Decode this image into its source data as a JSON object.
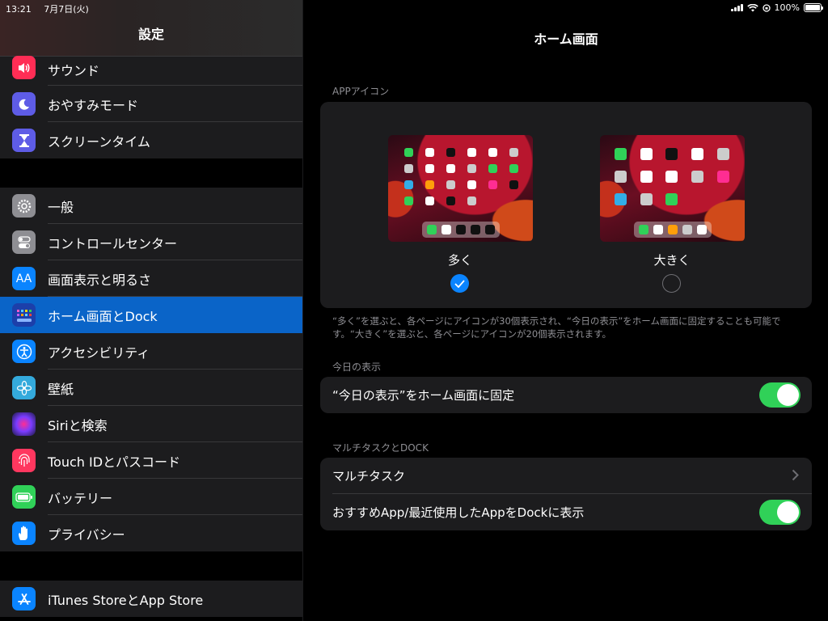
{
  "status": {
    "time": "13:21",
    "date": "7月7日(火)",
    "battery": "100%"
  },
  "sidebar": {
    "title": "設定",
    "group1": [
      {
        "label": "サウンド",
        "icon": "speaker-icon",
        "color": "#ff2d55"
      },
      {
        "label": "おやすみモード",
        "icon": "moon-icon",
        "color": "#5e5ce6"
      },
      {
        "label": "スクリーンタイム",
        "icon": "hourglass-icon",
        "color": "#5e5ce6"
      }
    ],
    "group2": [
      {
        "label": "一般",
        "icon": "gear-icon",
        "color": "#8e8e93"
      },
      {
        "label": "コントロールセンター",
        "icon": "switches-icon",
        "color": "#8e8e93"
      },
      {
        "label": "画面表示と明るさ",
        "icon": "text-size-icon",
        "color": "#0a84ff"
      },
      {
        "label": "ホーム画面とDock",
        "icon": "home-grid-icon",
        "color": "#1c3faa"
      },
      {
        "label": "アクセシビリティ",
        "icon": "accessibility-icon",
        "color": "#0a84ff"
      },
      {
        "label": "壁紙",
        "icon": "flower-icon",
        "color": "#34aadc"
      },
      {
        "label": "Siriと検索",
        "icon": "siri-icon",
        "color": "#2c2c2e"
      },
      {
        "label": "Touch IDとパスコード",
        "icon": "fingerprint-icon",
        "color": "#ff375f"
      },
      {
        "label": "バッテリー",
        "icon": "battery-icon",
        "color": "#30d158"
      },
      {
        "label": "プライバシー",
        "icon": "hand-icon",
        "color": "#0a84ff"
      }
    ],
    "group3": [
      {
        "label": "iTunes StoreとApp Store",
        "icon": "app-store-icon",
        "color": "#0a84ff"
      }
    ]
  },
  "main": {
    "title": "ホーム画面",
    "app_icons_header": "APPアイコン",
    "option_more": "多く",
    "option_bigger": "大きく",
    "selected_option": "多く",
    "note": "“多く”を選ぶと、各ページにアイコンが30個表示され、“今日の表示”をホーム画面に固定することも可能です。“大きく”を選ぶと、各ページにアイコンが20個表示されます。",
    "today_header": "今日の表示",
    "today_pin_label": "“今日の表示”をホーム画面に固定",
    "today_pin_on": true,
    "multitask_header": "マルチタスクとDOCK",
    "multitask_label": "マルチタスク",
    "suggested_label": "おすすめApp/最近使用したAppをDockに表示",
    "suggested_on": true
  },
  "colors": {
    "accent": "#0a84ff",
    "toggle_on": "#30d158",
    "selected_row": "#0a64c8"
  }
}
